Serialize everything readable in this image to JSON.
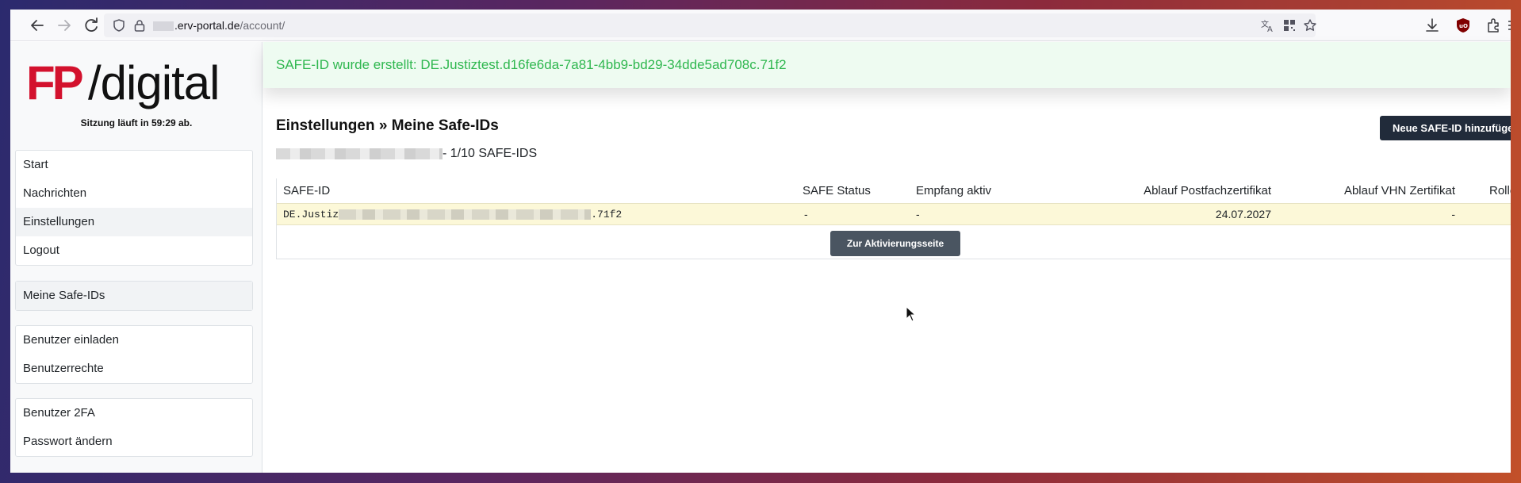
{
  "browser": {
    "url_host": ".erv-portal.de",
    "url_path": "/account/",
    "icons": [
      "back-arrow-icon",
      "forward-arrow-icon",
      "reload-icon",
      "shield-icon",
      "lock-icon",
      "translate-icon",
      "qr-code-icon",
      "bookmark-star-icon",
      "download-icon",
      "ublock-icon",
      "extensions-icon",
      "menu-icon"
    ]
  },
  "sidebar": {
    "logo": {
      "fp": "FP",
      "digital": "/digital"
    },
    "session_text": "Sitzung läuft in 59:29 ab.",
    "groups": [
      {
        "items": [
          {
            "label": "Start"
          },
          {
            "label": "Nachrichten"
          },
          {
            "label": "Einstellungen",
            "active": true
          },
          {
            "label": "Logout"
          }
        ]
      },
      {
        "items": [
          {
            "label": "Meine Safe-IDs",
            "active": true
          }
        ]
      },
      {
        "items": [
          {
            "label": "Benutzer einladen"
          },
          {
            "label": "Benutzerrechte"
          }
        ]
      },
      {
        "items": [
          {
            "label": "Benutzer 2FA"
          },
          {
            "label": "Passwort ändern"
          }
        ]
      }
    ]
  },
  "main": {
    "alert_text": "SAFE-ID wurde erstellt: DE.Justiztest.d16fe6da-7a81-4bb9-bd29-34dde5ad708c.71f2",
    "title": "Einstellungen » Meine Safe-IDs",
    "count_suffix": "- 1/10 SAFE-IDS",
    "new_button": "Neue SAFE-ID hinzufügen",
    "table": {
      "headers": [
        "SAFE-ID",
        "SAFE Status",
        "Empfang aktiv",
        "Ablauf Postfachzertifikat",
        "Ablauf VHN Zertifikat",
        "Rollen"
      ],
      "rows": [
        {
          "safe_id_start": "DE.Justiz",
          "safe_id_end": ".71f2",
          "status": "-",
          "empfang": "-",
          "ablauf_postfach": "24.07.2027",
          "ablauf_vhn": "-"
        }
      ],
      "activate_button": "Zur Aktivierungsseite"
    }
  },
  "colors": {
    "brand_red": "#d3112d",
    "alert_green": "#2fb74f",
    "alert_bg": "#eefbf1",
    "row_highlight": "#fcf8d8",
    "dark_button": "#212b3a"
  }
}
